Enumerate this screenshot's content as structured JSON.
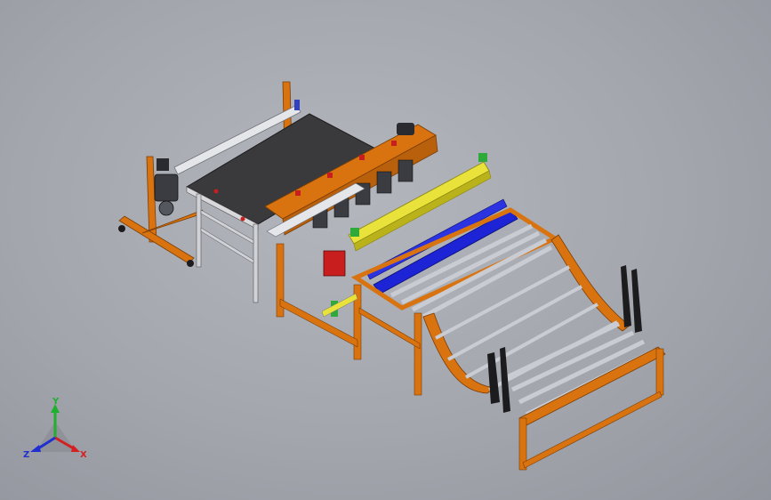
{
  "view": {
    "background_color": "#a8abb2"
  },
  "colors": {
    "frame": "#d9730f",
    "frame_dark": "#9c4f08",
    "belt": "#3a3a3c",
    "roller": "#c9ccd2",
    "yellow_bar": "#e8e23a",
    "blue_bar": "#1d24d6",
    "silver": "#e4e6ea",
    "red_part": "#c81e1e",
    "green_part": "#2faa3a",
    "black_part": "#1c1c1e"
  },
  "triad": {
    "x_label": "X",
    "y_label": "Y",
    "z_label": "Z",
    "x_color": "#d42020",
    "y_color": "#20b030",
    "z_color": "#2030d0"
  }
}
